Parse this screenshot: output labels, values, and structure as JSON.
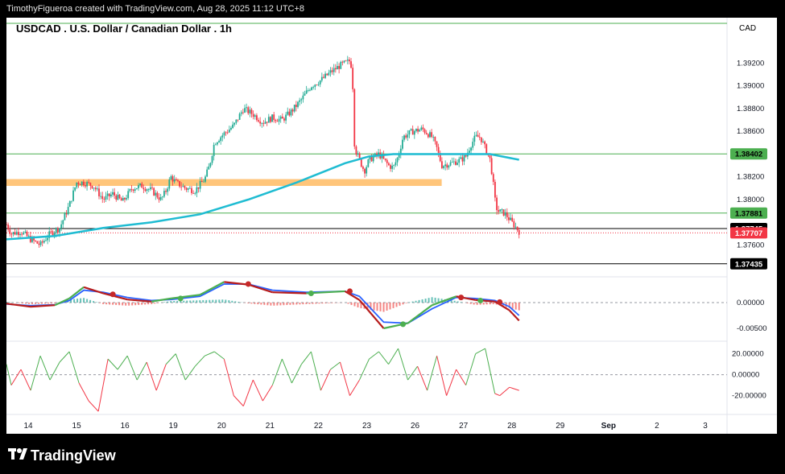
{
  "header": {
    "attribution": "TimothyFigueroa created with TradingView.com, Aug 28, 2025 11:12 UTC+8"
  },
  "footer": {
    "brand": "TradingView"
  },
  "chart_data": {
    "type": "candlestick",
    "title": "USDCAD . U.S. Dollar / Canadian Dollar . 1h",
    "currency": "CAD",
    "x_labels": [
      "14",
      "15",
      "16",
      "19",
      "20",
      "21",
      "22",
      "23",
      "26",
      "27",
      "28",
      "29",
      "Sep",
      "2",
      "3"
    ],
    "price_axis": {
      "ylim": [
        1.3732,
        1.396
      ],
      "ticks": [
        "1.39200",
        "1.39000",
        "1.38800",
        "1.38600",
        "1.38200",
        "1.38000",
        "1.37600"
      ]
    },
    "price_badges": [
      {
        "label": "1.38402",
        "value": 1.38402,
        "color": "#4caf50",
        "text_color": "#000000"
      },
      {
        "label": "1.37881",
        "value": 1.37881,
        "color": "#4caf50",
        "text_color": "#000000"
      },
      {
        "label": "1.37745",
        "value": 1.37745,
        "color": "#000000",
        "text_color": "#ffffff"
      },
      {
        "label": "1.37707",
        "value": 1.37707,
        "color": "#f23645",
        "text_color": "#ffffff"
      },
      {
        "label": "1.37435",
        "value": 1.37435,
        "color": "#000000",
        "text_color": "#ffffff"
      }
    ],
    "horizontal_lines": [
      {
        "value": 1.3955,
        "color": "#4caf50"
      },
      {
        "value": 1.38402,
        "color": "#4caf50"
      },
      {
        "value": 1.37881,
        "color": "#4caf50"
      },
      {
        "value": 1.37745,
        "color": "#000000"
      },
      {
        "value": 1.37435,
        "color": "#000000"
      }
    ],
    "resistance_zone": {
      "top": 1.3818,
      "bottom": 1.3812,
      "from": 0,
      "to": 0.9,
      "color": "#ffc57a"
    },
    "price_path": [
      [
        0,
        1.3778
      ],
      [
        0.01,
        1.377
      ],
      [
        0.03,
        1.3772
      ],
      [
        0.05,
        1.3765
      ],
      [
        0.07,
        1.376
      ],
      [
        0.09,
        1.377
      ],
      [
        0.11,
        1.3775
      ],
      [
        0.13,
        1.3795
      ],
      [
        0.145,
        1.3815
      ],
      [
        0.16,
        1.3815
      ],
      [
        0.18,
        1.3812
      ],
      [
        0.2,
        1.38
      ],
      [
        0.22,
        1.3805
      ],
      [
        0.24,
        1.3798
      ],
      [
        0.26,
        1.381
      ],
      [
        0.28,
        1.3812
      ],
      [
        0.3,
        1.3808
      ],
      [
        0.32,
        1.38
      ],
      [
        0.33,
        1.3808
      ],
      [
        0.34,
        1.382
      ],
      [
        0.35,
        1.3815
      ],
      [
        0.37,
        1.381
      ],
      [
        0.39,
        1.3808
      ],
      [
        0.41,
        1.3818
      ],
      [
        0.42,
        1.383
      ],
      [
        0.43,
        1.385
      ],
      [
        0.45,
        1.3858
      ],
      [
        0.47,
        1.3865
      ],
      [
        0.49,
        1.388
      ],
      [
        0.51,
        1.3875
      ],
      [
        0.53,
        1.3868
      ],
      [
        0.55,
        1.3872
      ],
      [
        0.57,
        1.387
      ],
      [
        0.59,
        1.3878
      ],
      [
        0.61,
        1.3888
      ],
      [
        0.63,
        1.39
      ],
      [
        0.65,
        1.3905
      ],
      [
        0.67,
        1.3912
      ],
      [
        0.69,
        1.3918
      ],
      [
        0.71,
        1.3922
      ],
      [
        0.715,
        1.3915
      ],
      [
        0.72,
        1.3845
      ],
      [
        0.73,
        1.3835
      ],
      [
        0.74,
        1.3825
      ],
      [
        0.75,
        1.3835
      ],
      [
        0.77,
        1.384
      ],
      [
        0.79,
        1.383
      ],
      [
        0.8,
        1.3828
      ],
      [
        0.81,
        1.3838
      ],
      [
        0.82,
        1.3855
      ],
      [
        0.84,
        1.386
      ],
      [
        0.86,
        1.3862
      ],
      [
        0.88,
        1.3855
      ],
      [
        0.89,
        1.3845
      ],
      [
        0.9,
        1.383
      ],
      [
        0.92,
        1.3832
      ],
      [
        0.94,
        1.3835
      ],
      [
        0.95,
        1.3838
      ],
      [
        0.96,
        1.3848
      ],
      [
        0.97,
        1.3855
      ],
      [
        0.98,
        1.3855
      ],
      [
        0.99,
        1.3845
      ],
      [
        1.0,
        1.3835
      ],
      [
        1.005,
        1.382
      ],
      [
        1.01,
        1.38
      ],
      [
        1.015,
        1.379
      ],
      [
        1.03,
        1.3788
      ],
      [
        1.045,
        1.378
      ],
      [
        1.06,
        1.3772
      ]
    ],
    "ma_path": [
      [
        0,
        1.3765
      ],
      [
        0.1,
        1.3768
      ],
      [
        0.2,
        1.3775
      ],
      [
        0.3,
        1.378
      ],
      [
        0.4,
        1.3787
      ],
      [
        0.5,
        1.38
      ],
      [
        0.6,
        1.3815
      ],
      [
        0.7,
        1.3832
      ],
      [
        0.75,
        1.3838
      ],
      [
        0.8,
        1.384
      ],
      [
        0.9,
        1.384
      ],
      [
        1.0,
        1.384
      ],
      [
        1.06,
        1.3835
      ]
    ],
    "x_tick_positions": [
      0.045,
      0.145,
      0.245,
      0.345,
      0.445,
      0.545,
      0.645,
      0.745,
      0.845,
      0.945,
      1.045,
      1.145,
      1.245,
      1.345,
      1.445
    ],
    "macd": {
      "yticks": [
        "0.00000",
        "-0.00500"
      ],
      "ylim": [
        -0.0075,
        0.005
      ],
      "fast": [
        [
          0,
          -0.0002
        ],
        [
          0.05,
          -0.0008
        ],
        [
          0.1,
          -0.0005
        ],
        [
          0.13,
          0.0008
        ],
        [
          0.16,
          0.003
        ],
        [
          0.2,
          0.0018
        ],
        [
          0.25,
          0.0006
        ],
        [
          0.3,
          0.0002
        ],
        [
          0.34,
          0.0008
        ],
        [
          0.4,
          0.0015
        ],
        [
          0.45,
          0.004
        ],
        [
          0.5,
          0.0035
        ],
        [
          0.55,
          0.002
        ],
        [
          0.62,
          0.0018
        ],
        [
          0.7,
          0.0022
        ],
        [
          0.73,
          0.0005
        ],
        [
          0.78,
          -0.005
        ],
        [
          0.83,
          -0.004
        ],
        [
          0.88,
          -0.0005
        ],
        [
          0.93,
          0.0012
        ],
        [
          0.97,
          0.0005
        ],
        [
          1.01,
          0.0002
        ],
        [
          1.04,
          -0.0015
        ],
        [
          1.06,
          -0.0035
        ]
      ],
      "slow": [
        [
          0,
          -0.0003
        ],
        [
          0.05,
          -0.0006
        ],
        [
          0.1,
          -0.0004
        ],
        [
          0.13,
          0.0004
        ],
        [
          0.16,
          0.0024
        ],
        [
          0.2,
          0.002
        ],
        [
          0.25,
          0.001
        ],
        [
          0.3,
          0.0004
        ],
        [
          0.34,
          0.0006
        ],
        [
          0.4,
          0.0012
        ],
        [
          0.45,
          0.0036
        ],
        [
          0.5,
          0.0036
        ],
        [
          0.55,
          0.0024
        ],
        [
          0.62,
          0.002
        ],
        [
          0.7,
          0.0022
        ],
        [
          0.73,
          0.0012
        ],
        [
          0.78,
          -0.0038
        ],
        [
          0.83,
          -0.004
        ],
        [
          0.88,
          -0.0012
        ],
        [
          0.93,
          0.001
        ],
        [
          0.97,
          0.0008
        ],
        [
          1.01,
          0.0004
        ],
        [
          1.04,
          -0.0008
        ],
        [
          1.06,
          -0.0025
        ]
      ],
      "cross_points": [
        [
          0.22,
          0.0016,
          "red"
        ],
        [
          0.36,
          0.0008,
          "green"
        ],
        [
          0.5,
          0.0036,
          "red"
        ],
        [
          0.63,
          0.0018,
          "green"
        ],
        [
          0.71,
          0.0022,
          "red"
        ],
        [
          0.82,
          -0.0042,
          "green"
        ],
        [
          0.94,
          0.001,
          "red"
        ],
        [
          0.98,
          0.0004,
          "green"
        ],
        [
          1.02,
          0.0001,
          "red"
        ]
      ]
    },
    "oscillator": {
      "yticks": [
        "20.00000",
        "0.00000",
        "-20.00000"
      ],
      "ylim": [
        -38,
        32
      ],
      "series": [
        [
          0,
          10
        ],
        [
          0.01,
          -10
        ],
        [
          0.03,
          5
        ],
        [
          0.05,
          -15
        ],
        [
          0.07,
          18
        ],
        [
          0.09,
          -5
        ],
        [
          0.11,
          12
        ],
        [
          0.13,
          22
        ],
        [
          0.15,
          -8
        ],
        [
          0.17,
          -25
        ],
        [
          0.19,
          -35
        ],
        [
          0.21,
          15
        ],
        [
          0.23,
          5
        ],
        [
          0.25,
          18
        ],
        [
          0.27,
          -5
        ],
        [
          0.29,
          12
        ],
        [
          0.31,
          -15
        ],
        [
          0.33,
          10
        ],
        [
          0.35,
          20
        ],
        [
          0.37,
          -5
        ],
        [
          0.39,
          8
        ],
        [
          0.41,
          18
        ],
        [
          0.43,
          22
        ],
        [
          0.45,
          15
        ],
        [
          0.47,
          -20
        ],
        [
          0.49,
          -30
        ],
        [
          0.51,
          -5
        ],
        [
          0.53,
          -25
        ],
        [
          0.55,
          -10
        ],
        [
          0.57,
          15
        ],
        [
          0.59,
          -8
        ],
        [
          0.61,
          10
        ],
        [
          0.63,
          22
        ],
        [
          0.65,
          -15
        ],
        [
          0.67,
          5
        ],
        [
          0.69,
          12
        ],
        [
          0.71,
          -20
        ],
        [
          0.73,
          -5
        ],
        [
          0.75,
          15
        ],
        [
          0.77,
          22
        ],
        [
          0.79,
          10
        ],
        [
          0.81,
          25
        ],
        [
          0.83,
          -5
        ],
        [
          0.85,
          8
        ],
        [
          0.87,
          -15
        ],
        [
          0.89,
          18
        ],
        [
          0.91,
          -20
        ],
        [
          0.93,
          5
        ],
        [
          0.95,
          -10
        ],
        [
          0.97,
          20
        ],
        [
          0.99,
          25
        ],
        [
          1.01,
          -18
        ],
        [
          1.02,
          -20
        ],
        [
          1.04,
          -12
        ],
        [
          1.06,
          -15
        ]
      ]
    }
  }
}
